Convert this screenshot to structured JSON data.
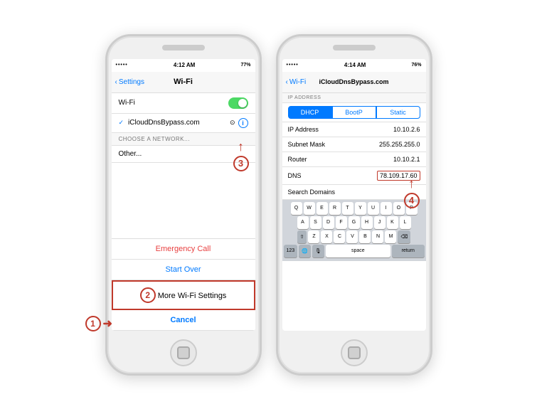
{
  "phone1": {
    "statusBar": {
      "dots": "•••••",
      "signal": "▼",
      "time": "4:12 AM",
      "battery": "77%"
    },
    "navBack": "Settings",
    "navTitle": "Wi-Fi",
    "wifi": {
      "label": "Wi-Fi",
      "networkName": "iCloudDnsBypass.com",
      "otherLabel": "Other...",
      "chooseSectionHeader": "CHOOSE A NETWORK..."
    },
    "actionSheet": {
      "emergencyCall": "Emergency Call",
      "startOver": "Start Over",
      "moreWifiSettings": "More Wi-Fi Settings",
      "cancel": "Cancel"
    },
    "steps": {
      "step1Label": "1",
      "step2Label": "2"
    }
  },
  "phone2": {
    "statusBar": {
      "dots": "•••••",
      "time": "4:14 AM",
      "battery": "76%"
    },
    "navBack": "Wi-Fi",
    "navTitle": "iCloudDnsBypass.com",
    "sections": {
      "ipAddress": "IP ADDRESS"
    },
    "segments": [
      "DHCP",
      "BootP",
      "Static"
    ],
    "rows": [
      {
        "label": "IP Address",
        "value": "10.10.2.6"
      },
      {
        "label": "Subnet Mask",
        "value": "255.255.255.0"
      },
      {
        "label": "Router",
        "value": "10.10.2.1"
      },
      {
        "label": "DNS",
        "value": "78.109.17.60",
        "highlight": true
      },
      {
        "label": "Search Domains",
        "value": ""
      }
    ],
    "keyboard": {
      "row1": [
        "Q",
        "W",
        "E",
        "R",
        "T",
        "Y",
        "U",
        "I",
        "O",
        "P"
      ],
      "row2": [
        "A",
        "S",
        "D",
        "F",
        "G",
        "H",
        "J",
        "K",
        "L"
      ],
      "row3": [
        "Z",
        "X",
        "C",
        "V",
        "B",
        "N",
        "M"
      ],
      "spaceLabel": "space",
      "returnLabel": "return",
      "key123": "123",
      "deleteSymbol": "⌫",
      "shiftSymbol": "⇧",
      "globeSymbol": "🌐",
      "micSymbol": "🎙"
    },
    "steps": {
      "step4Label": "4"
    }
  },
  "stepArrows": {
    "arrowSymbol": "➜",
    "upArrowSymbol": "↑"
  }
}
